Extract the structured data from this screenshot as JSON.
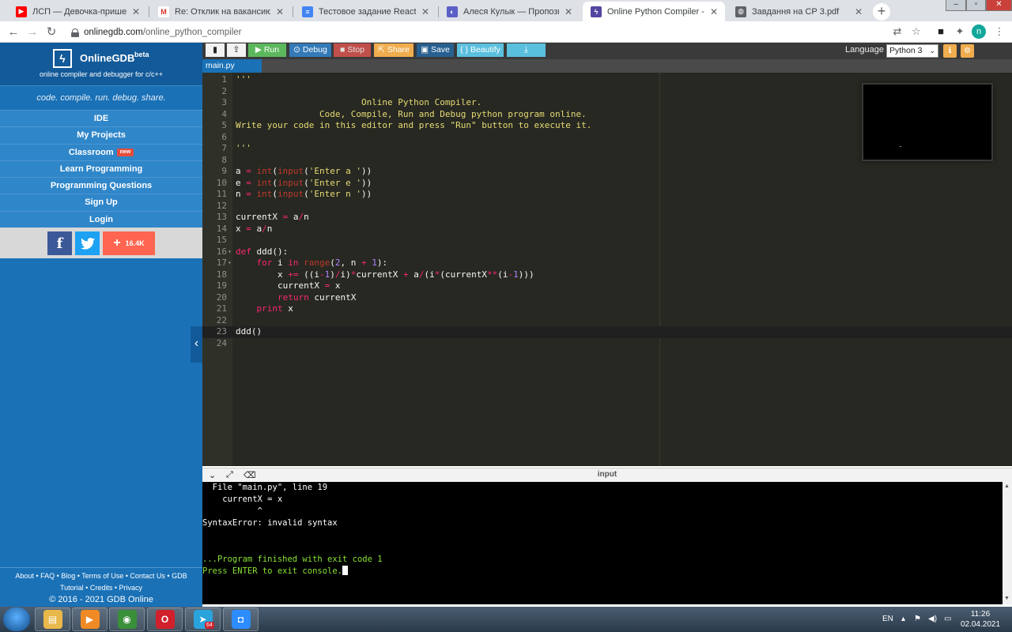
{
  "browser": {
    "tabs": [
      {
        "title": "ЛСП — Девочка-пришелец - Yo",
        "favicon": "youtube-icon",
        "color": "#ff0000",
        "glyph": "▶",
        "active": false
      },
      {
        "title": "Re: Отклик на вакансию olehmy",
        "favicon": "gmail-icon",
        "color": "#ffffff",
        "glyph": "M",
        "active": false
      },
      {
        "title": "Тестовое задание React-Native",
        "favicon": "docs-icon",
        "color": "#4285f4",
        "glyph": "≡",
        "active": false
      },
      {
        "title": "Алеся Кулык — Пропозиції — Д",
        "favicon": "app-icon",
        "color": "#5b5fc7",
        "glyph": "◐",
        "active": false
      },
      {
        "title": "Online Python Compiler - online",
        "favicon": "onlinegdb-icon",
        "color": "#5146a0",
        "glyph": "ϟ",
        "active": true
      },
      {
        "title": "Завдання на СР 3.pdf",
        "favicon": "globe-icon",
        "color": "#5f6368",
        "glyph": "◍",
        "active": false
      }
    ],
    "new_tab_label": "+",
    "url_domain": "onlinegdb.com",
    "url_path": "/online_python_compiler",
    "profile_letter": "n"
  },
  "sidebar": {
    "brand_name": "OnlineGDB",
    "brand_beta": "beta",
    "brand_sub": "online compiler and debugger for c/c++",
    "tagline": "code. compile. run. debug. share.",
    "menu": [
      "IDE",
      "My Projects",
      "Classroom",
      "Learn Programming",
      "Programming Questions",
      "Sign Up",
      "Login"
    ],
    "new_badge": "new",
    "social": {
      "facebook": "f",
      "twitter": "t",
      "share_count": "16.4K"
    },
    "footer_line1": "About • FAQ • Blog • Terms of Use • Contact Us • GDB",
    "footer_line2": "Tutorial • Credits • Privacy",
    "footer_copy": "© 2016 - 2021 GDB Online"
  },
  "toolbar": {
    "run": "Run",
    "debug": "Debug",
    "stop": "Stop",
    "share": "Share",
    "save": "Save",
    "beautify": "{ } Beautify",
    "language_label": "Language",
    "language_value": "Python 3",
    "colors": {
      "run": "#5cb85c",
      "debug": "#337ab7",
      "stop": "#d9534f",
      "share": "#f0ad4e",
      "save": "#286090",
      "beautify": "#5bc0de",
      "download": "#5bc0de"
    }
  },
  "file_tab": "main.py",
  "editor": {
    "lines": [
      [
        {
          "t": "'''",
          "c": "s"
        }
      ],
      [],
      [
        {
          "t": "                        Online Python Compiler.",
          "c": "s"
        }
      ],
      [
        {
          "t": "                Code, Compile, Run and Debug python program online.",
          "c": "s"
        }
      ],
      [
        {
          "t": "Write your code in this editor and press \"Run\" button to execute it.",
          "c": "s"
        }
      ],
      [],
      [
        {
          "t": "'''",
          "c": "s"
        }
      ],
      [],
      [
        {
          "t": "a ",
          "c": "p"
        },
        {
          "t": "=",
          "c": "k"
        },
        {
          "t": " ",
          "c": "p"
        },
        {
          "t": "int",
          "c": "b"
        },
        {
          "t": "(",
          "c": "p"
        },
        {
          "t": "input",
          "c": "b"
        },
        {
          "t": "(",
          "c": "p"
        },
        {
          "t": "'Enter a '",
          "c": "s"
        },
        {
          "t": "))",
          "c": "p"
        }
      ],
      [
        {
          "t": "e ",
          "c": "p"
        },
        {
          "t": "=",
          "c": "k"
        },
        {
          "t": " ",
          "c": "p"
        },
        {
          "t": "int",
          "c": "b"
        },
        {
          "t": "(",
          "c": "p"
        },
        {
          "t": "input",
          "c": "b"
        },
        {
          "t": "(",
          "c": "p"
        },
        {
          "t": "'Enter e '",
          "c": "s"
        },
        {
          "t": "))",
          "c": "p"
        }
      ],
      [
        {
          "t": "n ",
          "c": "p"
        },
        {
          "t": "=",
          "c": "k"
        },
        {
          "t": " ",
          "c": "p"
        },
        {
          "t": "int",
          "c": "b"
        },
        {
          "t": "(",
          "c": "p"
        },
        {
          "t": "input",
          "c": "b"
        },
        {
          "t": "(",
          "c": "p"
        },
        {
          "t": "'Enter n '",
          "c": "s"
        },
        {
          "t": "))",
          "c": "p"
        }
      ],
      [],
      [
        {
          "t": "currentX ",
          "c": "p"
        },
        {
          "t": "=",
          "c": "k"
        },
        {
          "t": " a",
          "c": "p"
        },
        {
          "t": "/",
          "c": "k"
        },
        {
          "t": "n",
          "c": "p"
        }
      ],
      [
        {
          "t": "x ",
          "c": "p"
        },
        {
          "t": "=",
          "c": "k"
        },
        {
          "t": " a",
          "c": "p"
        },
        {
          "t": "/",
          "c": "k"
        },
        {
          "t": "n",
          "c": "p"
        }
      ],
      [],
      [
        {
          "t": "def",
          "c": "k"
        },
        {
          "t": " ddd():",
          "c": "p"
        }
      ],
      [
        {
          "t": "    ",
          "c": "p"
        },
        {
          "t": "for",
          "c": "k"
        },
        {
          "t": " i ",
          "c": "p"
        },
        {
          "t": "in",
          "c": "k"
        },
        {
          "t": " ",
          "c": "p"
        },
        {
          "t": "range",
          "c": "b"
        },
        {
          "t": "(",
          "c": "p"
        },
        {
          "t": "2",
          "c": "n"
        },
        {
          "t": ", n ",
          "c": "p"
        },
        {
          "t": "+",
          "c": "k"
        },
        {
          "t": " ",
          "c": "p"
        },
        {
          "t": "1",
          "c": "n"
        },
        {
          "t": "):",
          "c": "p"
        }
      ],
      [
        {
          "t": "        x ",
          "c": "p"
        },
        {
          "t": "+=",
          "c": "k"
        },
        {
          "t": " ((i",
          "c": "p"
        },
        {
          "t": "-",
          "c": "k"
        },
        {
          "t": "1",
          "c": "n"
        },
        {
          "t": ")",
          "c": "p"
        },
        {
          "t": "/",
          "c": "k"
        },
        {
          "t": "i)",
          "c": "p"
        },
        {
          "t": "*",
          "c": "k"
        },
        {
          "t": "currentX ",
          "c": "p"
        },
        {
          "t": "+",
          "c": "k"
        },
        {
          "t": " a",
          "c": "p"
        },
        {
          "t": "/",
          "c": "k"
        },
        {
          "t": "(i",
          "c": "p"
        },
        {
          "t": "*",
          "c": "k"
        },
        {
          "t": "(currentX",
          "c": "p"
        },
        {
          "t": "**",
          "c": "k"
        },
        {
          "t": "(i",
          "c": "p"
        },
        {
          "t": "-",
          "c": "k"
        },
        {
          "t": "1",
          "c": "n"
        },
        {
          "t": ")))",
          "c": "p"
        }
      ],
      [
        {
          "t": "        currentX ",
          "c": "p"
        },
        {
          "t": "=",
          "c": "k"
        },
        {
          "t": " x",
          "c": "p"
        }
      ],
      [
        {
          "t": "        ",
          "c": "p"
        },
        {
          "t": "return",
          "c": "k"
        },
        {
          "t": " currentX",
          "c": "p"
        }
      ],
      [
        {
          "t": "    ",
          "c": "p"
        },
        {
          "t": "print",
          "c": "k"
        },
        {
          "t": " x",
          "c": "p"
        }
      ],
      [],
      [
        {
          "t": "ddd()",
          "c": "p"
        }
      ],
      []
    ],
    "fold_lines": [
      16,
      17
    ],
    "active_line": 23
  },
  "output": {
    "title": "input",
    "lines": [
      {
        "text": "  File \"main.py\", line 19",
        "color": "white"
      },
      {
        "text": "    currentX = x",
        "color": "white"
      },
      {
        "text": "           ^",
        "color": "white"
      },
      {
        "text": "SyntaxError: invalid syntax",
        "color": "white"
      },
      {
        "text": "",
        "color": "white"
      },
      {
        "text": "",
        "color": "white"
      },
      {
        "text": "...Program finished with exit code 1",
        "color": "green"
      },
      {
        "text": "Press ENTER to exit console.",
        "color": "green"
      }
    ]
  },
  "taskbar": {
    "apps": [
      {
        "name": "explorer",
        "color": "#e8b84a",
        "glyph": "▤"
      },
      {
        "name": "media-player",
        "color": "#f08a24",
        "glyph": "▶"
      },
      {
        "name": "chrome",
        "color": "#3a8f3a",
        "glyph": "◉"
      },
      {
        "name": "opera",
        "color": "#d0202b",
        "glyph": "O"
      },
      {
        "name": "telegram",
        "color": "#2aa3dd",
        "glyph": "➤"
      },
      {
        "name": "zoom",
        "color": "#2d8cff",
        "glyph": "◘"
      }
    ],
    "telegram_badge": "64",
    "lang": "EN",
    "time": "11:26",
    "date": "02.04.2021"
  }
}
